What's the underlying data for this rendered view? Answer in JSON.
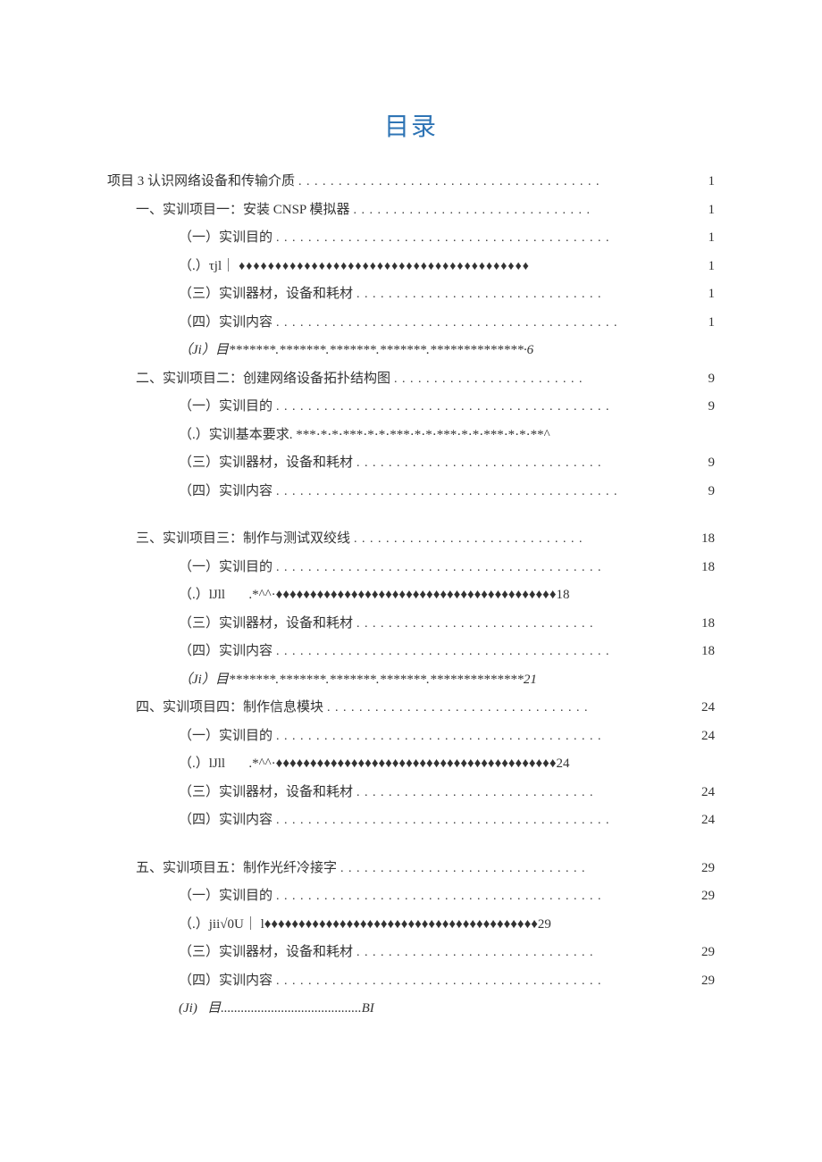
{
  "title": "目录",
  "entries": [
    {
      "level": 0,
      "label": "项目 3 认识网络设备和传输介质",
      "leader": ". . . . . . . . . . . . . . . . . . . . . . . . . . . . . . . . . . . . . .",
      "page": "1",
      "style": "dotted"
    },
    {
      "level": 1,
      "label": "一、实训项目一：安装 CNSP 模拟器",
      "leader": ". . . . . . . . . . . . . . . . . . . . . . . . . . . . . .",
      "page": "1",
      "style": "dotted"
    },
    {
      "level": 2,
      "label": "（一）实训目的",
      "leader": ". . . . . . . . . . . . . . . . . . . . . . . . . . . . . . . . . . . . . . . . . .",
      "page": "1",
      "style": "dotted"
    },
    {
      "level": 2,
      "label": "（.）τjl｜",
      "leader": "♦♦♦♦♦♦♦♦♦♦♦♦♦♦♦♦♦♦♦♦♦♦♦♦♦♦♦♦♦♦♦♦♦♦♦♦♦♦♦♦",
      "page": "1",
      "style": "diamond"
    },
    {
      "level": 2,
      "label": "（三）实训器材，设备和耗材",
      "leader": ". . . . . . . . . . . . . . . . . . . . . . . . . . . . . . .",
      "page": "1",
      "style": "dotted"
    },
    {
      "level": 2,
      "label": "（四）实训内容",
      "leader": ". . . . . . . . . . . . . . . . . . . . . . . . . . . . . . . . . . . . . . . . . . .",
      "page": "1",
      "style": "dotted"
    },
    {
      "level": 2,
      "label": "（Ji）目*******.*******.*******.*******.**************·6",
      "leader": "",
      "page": "",
      "style": "raw",
      "italic": true
    },
    {
      "level": 1,
      "label": "二、实训项目二：创建网络设备拓扑结构图",
      "leader": ". . . . . . . . . . . . . . . . . . . . . . . .",
      "page": "9",
      "style": "dotted"
    },
    {
      "level": 2,
      "label": "（一）实训目的",
      "leader": ". . . . . . . . . . . . . . . . . . . . . . . . . . . . . . . . . . . . . . . . . .",
      "page": "9",
      "style": "dotted"
    },
    {
      "level": 2,
      "label": "（.）实训基本要求. ***·*·*·***·*·*·***·*·*·***·*·*·***·*·*·**^",
      "leader": "",
      "page": "",
      "style": "raw"
    },
    {
      "level": 2,
      "label": "（三）实训器材，设备和耗材",
      "leader": ". . . . . . . . . . . . . . . . . . . . . . . . . . . . . . .",
      "page": "9",
      "style": "dotted"
    },
    {
      "level": 2,
      "label": "（四）实训内容",
      "leader": ". . . . . . . . . . . . . . . . . . . . . . . . . . . . . . . . . . . . . . . . . . .",
      "page": "9",
      "style": "dotted"
    },
    {
      "level": -1,
      "label": "",
      "leader": "",
      "page": "",
      "style": "spacer"
    },
    {
      "level": 1,
      "label": "三、实训项目三：制作与测试双绞线",
      "leader": ". . . . . . . . . . . . . . . . . . . . . . . . . . . . .",
      "page": "18",
      "style": "dotted"
    },
    {
      "level": 2,
      "label": "（一）实训目的",
      "leader": ". . . . . . . . . . . . . . . . . . . . . . . . . . . . . . . . . . . . . . . . .",
      "page": "18",
      "style": "dotted"
    },
    {
      "level": 2,
      "label": "（.）lJll       .*^^·♦♦♦♦♦♦♦♦♦♦♦♦♦♦♦♦♦♦♦♦♦♦♦♦♦♦♦♦♦♦♦♦♦♦♦♦♦♦♦♦♦18",
      "leader": "",
      "page": "",
      "style": "raw"
    },
    {
      "level": 2,
      "label": "（三）实训器材，设备和耗材",
      "leader": ". . . . . . . . . . . . . . . . . . . . . . . . . . . . . .",
      "page": "18",
      "style": "dotted"
    },
    {
      "level": 2,
      "label": "（四）实训内容",
      "leader": ". . . . . . . . . . . . . . . . . . . . . . . . . . . . . . . . . . . . . . . . . .",
      "page": "18",
      "style": "dotted"
    },
    {
      "level": 2,
      "label": "（Ji）目*******.*******.*******.*******.**************21",
      "leader": "",
      "page": "",
      "style": "raw",
      "italic": true
    },
    {
      "level": 1,
      "label": "四、实训项目四：制作信息模块",
      "leader": ". . . . . . . . . . . . . . . . . . . . . . . . . . . . . . . . .",
      "page": "24",
      "style": "dotted"
    },
    {
      "level": 2,
      "label": "（一）实训目的",
      "leader": ". . . . . . . . . . . . . . . . . . . . . . . . . . . . . . . . . . . . . . . . .",
      "page": "24",
      "style": "dotted"
    },
    {
      "level": 2,
      "label": "（.）lJll       .*^^·♦♦♦♦♦♦♦♦♦♦♦♦♦♦♦♦♦♦♦♦♦♦♦♦♦♦♦♦♦♦♦♦♦♦♦♦♦♦♦♦♦24",
      "leader": "",
      "page": "",
      "style": "raw"
    },
    {
      "level": 2,
      "label": "（三）实训器材，设备和耗材",
      "leader": ". . . . . . . . . . . . . . . . . . . . . . . . . . . . . .",
      "page": "24",
      "style": "dotted"
    },
    {
      "level": 2,
      "label": "（四）实训内容",
      "leader": ". . . . . . . . . . . . . . . . . . . . . . . . . . . . . . . . . . . . . . . . . .",
      "page": "24",
      "style": "dotted"
    },
    {
      "level": -1,
      "label": "",
      "leader": "",
      "page": "",
      "style": "spacer"
    },
    {
      "level": 1,
      "label": "五、实训项目五：制作光纤冷接字",
      "leader": ". . . . . . . . . . . . . . . . . . . . . . . . . . . . . . .",
      "page": "29",
      "style": "dotted"
    },
    {
      "level": 2,
      "label": "（一）实训目的",
      "leader": ". . . . . . . . . . . . . . . . . . . . . . . . . . . . . . . . . . . . . . . . .",
      "page": "29",
      "style": "dotted"
    },
    {
      "level": 2,
      "label": "（.）jii√0U｜ l♦♦♦♦♦♦♦♦♦♦♦♦♦♦♦♦♦♦♦♦♦♦♦♦♦♦♦♦♦♦♦♦♦♦♦♦♦♦♦♦29",
      "leader": "",
      "page": "",
      "style": "raw"
    },
    {
      "level": 2,
      "label": "（三）实训器材，设备和耗材",
      "leader": ". . . . . . . . . . . . . . . . . . . . . . . . . . . . . .",
      "page": "29",
      "style": "dotted"
    },
    {
      "level": 2,
      "label": "（四）实训内容",
      "leader": ". . . . . . . . . . . . . . . . . . . . . . . . . . . . . . . . . . . . . . . . .",
      "page": "29",
      "style": "dotted"
    },
    {
      "level": 2,
      "label": "(Ji)   目..........................................BI",
      "leader": "",
      "page": "",
      "style": "raw",
      "italic": true
    }
  ]
}
